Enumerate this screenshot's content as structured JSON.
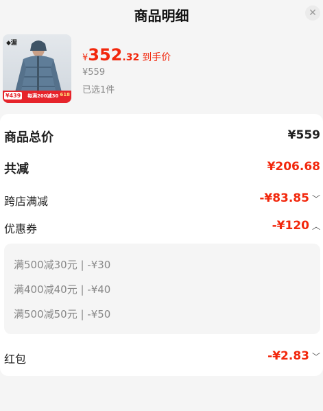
{
  "header": {
    "title": "商品明细",
    "close_icon": "close-icon"
  },
  "product": {
    "thumb_logo": "◆渥",
    "thumb_price": "¥439",
    "thumb_promo": "每满200减30",
    "thumb_badge": "618",
    "price_symbol": "¥",
    "price_int": "352",
    "price_dec": ".32",
    "price_tag": "到手价",
    "original_price": "¥559",
    "selected": "已选1件"
  },
  "summary": {
    "total_label": "商品总价",
    "total_value": "¥559",
    "discount_label": "共减",
    "discount_value": "¥206.68",
    "cross_store_label": "跨店满减",
    "cross_store_value": "-¥83.85",
    "coupon_label": "优惠券",
    "coupon_value": "-¥120",
    "red_packet_label": "红包",
    "red_packet_value": "-¥2.83"
  },
  "coupons": [
    "满500减30元 | -¥30",
    "满400减40元 | -¥40",
    "满500减50元 | -¥50"
  ],
  "colors": {
    "accent_red": "#f2270c",
    "background": "#f5f5f5"
  }
}
